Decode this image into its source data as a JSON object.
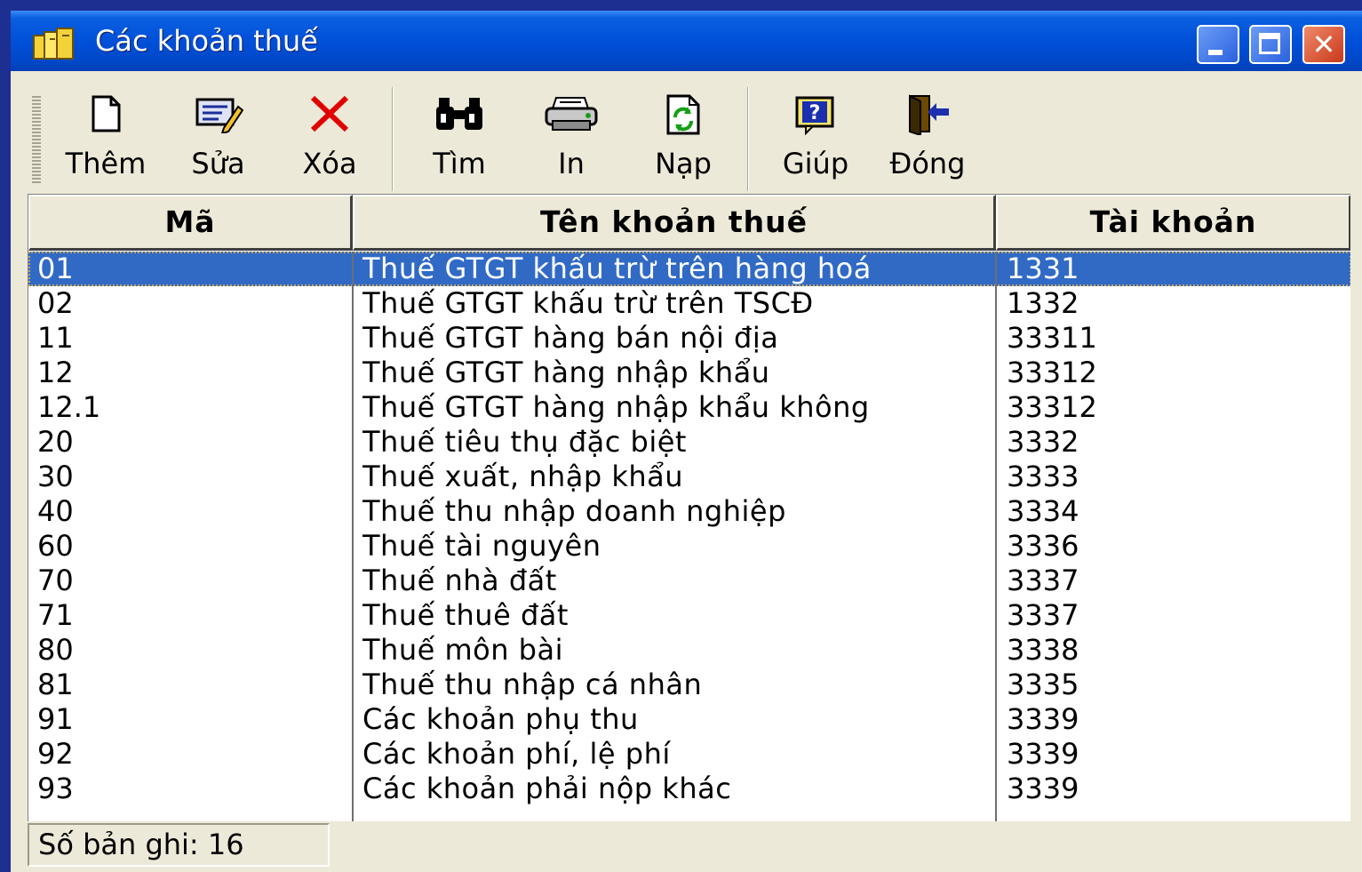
{
  "window": {
    "title": "Các khoản thuế",
    "icon": "folder-cabinet-icon"
  },
  "toolbar": {
    "buttons": [
      {
        "label": "Thêm",
        "icon": "new-document-icon"
      },
      {
        "label": "Sửa",
        "icon": "edit-pencil-icon"
      },
      {
        "label": "Xóa",
        "icon": "delete-x-icon"
      },
      {
        "label": "Tìm",
        "icon": "binoculars-icon"
      },
      {
        "label": "In",
        "icon": "printer-icon"
      },
      {
        "label": "Nạp",
        "icon": "refresh-icon"
      },
      {
        "label": "Giúp",
        "icon": "help-icon"
      },
      {
        "label": "Đóng",
        "icon": "exit-door-icon"
      }
    ]
  },
  "grid": {
    "columns": [
      "Mã",
      "Tên khoản thuế",
      "Tài khoản"
    ],
    "rows": [
      {
        "ma": "01",
        "ten": "Thuế GTGT khấu trừ trên hàng hoá",
        "tk": "1331",
        "selected": true
      },
      {
        "ma": "02",
        "ten": "Thuế GTGT khấu trừ trên TSCĐ",
        "tk": "1332"
      },
      {
        "ma": "11",
        "ten": "Thuế GTGT hàng bán nội địa",
        "tk": "33311"
      },
      {
        "ma": "12",
        "ten": "Thuế GTGT hàng nhập khẩu",
        "tk": "33312"
      },
      {
        "ma": "12.1",
        "ten": "Thuế GTGT hàng nhập khẩu không",
        "tk": "33312"
      },
      {
        "ma": "20",
        "ten": "Thuế tiêu thụ đặc biệt",
        "tk": "3332"
      },
      {
        "ma": "30",
        "ten": "Thuế xuất, nhập khẩu",
        "tk": "3333"
      },
      {
        "ma": "40",
        "ten": "Thuế thu nhập doanh nghiệp",
        "tk": "3334"
      },
      {
        "ma": "60",
        "ten": "Thuế tài nguyên",
        "tk": "3336"
      },
      {
        "ma": "70",
        "ten": "Thuế nhà đất",
        "tk": "3337"
      },
      {
        "ma": "71",
        "ten": "Thuế thuê đất",
        "tk": "3337"
      },
      {
        "ma": "80",
        "ten": "Thuế môn bài",
        "tk": "3338"
      },
      {
        "ma": "81",
        "ten": "Thuế thu nhập cá nhân",
        "tk": "3335"
      },
      {
        "ma": "91",
        "ten": "Các khoản phụ thu",
        "tk": "3339"
      },
      {
        "ma": "92",
        "ten": "Các khoản phí,  lệ phí",
        "tk": "3339"
      },
      {
        "ma": "93",
        "ten": "Các khoản phải nộp khác",
        "tk": "3339"
      }
    ]
  },
  "status": {
    "record_count": "Số bản ghi: 16"
  },
  "colors": {
    "titlebar": "#0050d8",
    "window_face": "#ece9d8",
    "desktop": "#1e2f92",
    "selection": "#316ac5"
  }
}
